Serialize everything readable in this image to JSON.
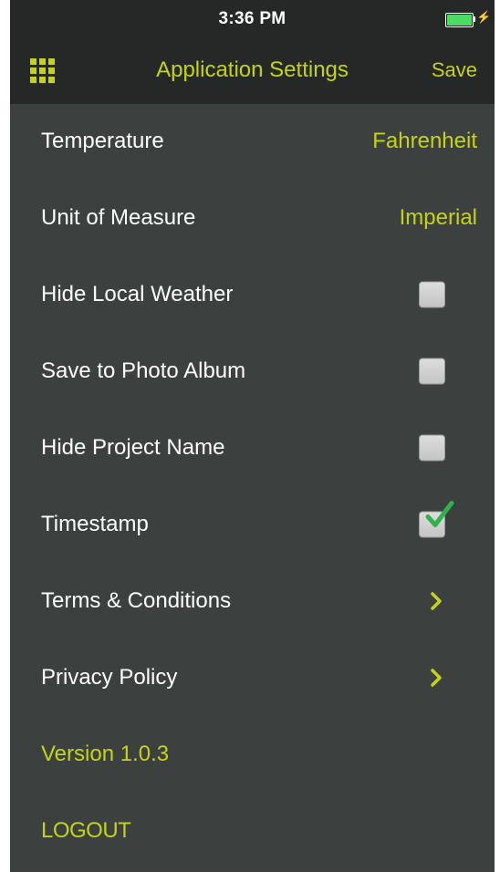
{
  "status_bar": {
    "time": "3:36 PM",
    "battery_color": "#4cd964",
    "bolt_icon": "⚡"
  },
  "nav": {
    "menu_icon": "grid-icon",
    "title": "Application Settings",
    "save_label": "Save"
  },
  "settings": {
    "temperature": {
      "label": "Temperature",
      "value": "Fahrenheit"
    },
    "unit_of_measure": {
      "label": "Unit of Measure",
      "value": "Imperial"
    },
    "hide_local_weather": {
      "label": "Hide Local Weather",
      "checked": false
    },
    "save_to_photo_album": {
      "label": "Save to Photo Album",
      "checked": false
    },
    "hide_project_name": {
      "label": "Hide Project Name",
      "checked": false
    },
    "timestamp": {
      "label": "Timestamp",
      "checked": true
    },
    "terms": {
      "label": "Terms & Conditions",
      "icon": "chevron-right-icon"
    },
    "privacy": {
      "label": "Privacy Policy",
      "icon": "chevron-right-icon"
    }
  },
  "version_text": "Version 1.0.3",
  "logout_label": "LOGOUT",
  "colors": {
    "accent": "#c6d313",
    "background": "#3c403e",
    "bar": "#252827",
    "check": "#2db34a"
  }
}
